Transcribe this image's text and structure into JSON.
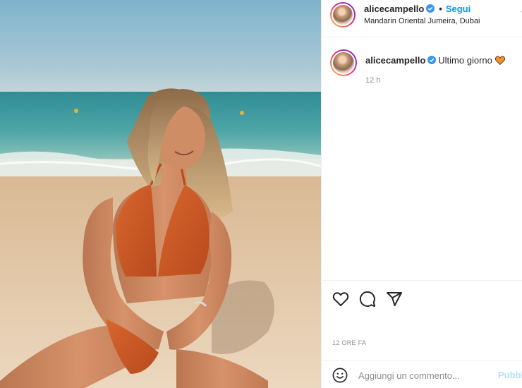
{
  "post": {
    "username": "alicecampello",
    "verified": true,
    "dot": "•",
    "follow_label": "Segui",
    "location": "Mandarin Oriental Jumeira, Dubai",
    "more_label": "•",
    "caption_text": "Ultimo giorno",
    "caption_emoji": "orange-heart",
    "caption_age": "12 h",
    "timestamp": "12 ORE FA"
  },
  "comment_box": {
    "placeholder": "Aggiungi un commento...",
    "publish_label": "Pubblica"
  },
  "icons": {
    "like": "heart-icon",
    "comment": "comment-icon",
    "share": "paper-plane-icon",
    "save": "bookmark-icon",
    "emoji": "smiley-icon",
    "verified": "verified-badge-icon"
  },
  "colors": {
    "accent": "#0095f6",
    "verified": "#3897f0",
    "muted": "#8e8e8e",
    "publish_disabled": "#b2dffc",
    "heart_emoji": "#f4902c"
  }
}
